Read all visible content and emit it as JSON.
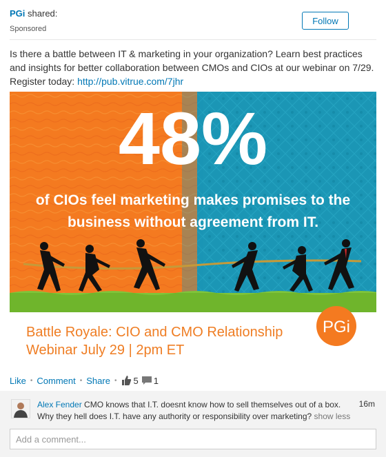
{
  "post": {
    "actor_name": "PGi",
    "actor_verb": "shared:",
    "sponsored_label": "Sponsored",
    "follow_label": "Follow",
    "text": "Is there a battle between IT & marketing in your organization? Learn best practices and insights for better collaboration between CMOs and CIOs at our webinar on 7/29. Register today: ",
    "link": "http://pub.vitrue.com/7jhr"
  },
  "banner": {
    "stat": "48%",
    "line1": "of CIOs feel marketing makes promises to the",
    "line2": "business without agreement from IT.",
    "title": "Battle Royale: CIO and CMO Relationship",
    "subtitle": "Webinar July 29 | 2pm ET",
    "logo": "PGi",
    "colors": {
      "orange": "#f47a20",
      "teal": "#1b96b5",
      "green": "#6fb52c",
      "text_orange": "#ef7d23"
    }
  },
  "social": {
    "like": "Like",
    "comment": "Comment",
    "share": "Share",
    "likes_count": "5",
    "comments_count": "1",
    "like_icon": "thumbs-up-icon",
    "comment_icon": "speech-bubble-icon"
  },
  "comment": {
    "author": "Alex Fender",
    "text": "CMO knows that I.T. doesnt know how to sell themselves out of a box. Why they hell does I.T. have any authority or responsibility over marketing?",
    "show_less": "show less",
    "time": "16m"
  },
  "add_comment": {
    "placeholder": "Add a comment..."
  }
}
